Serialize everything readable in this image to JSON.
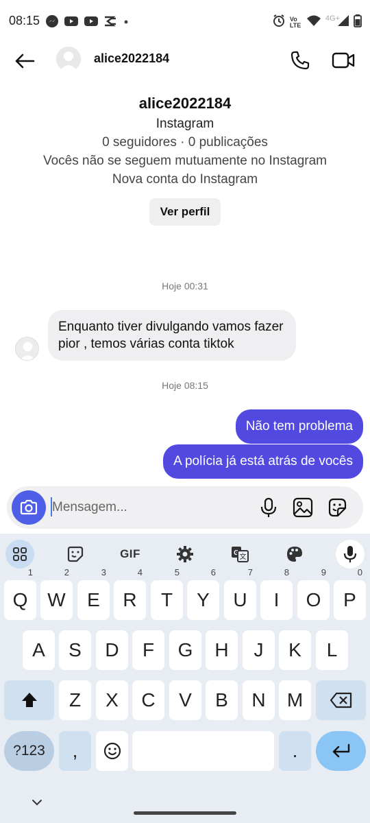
{
  "status_bar": {
    "time": "08:15",
    "left_icons": [
      "messenger-icon",
      "youtube-icon",
      "youtube-icon",
      "capcut-icon",
      "dot-icon"
    ],
    "right_icons": [
      "alarm-icon",
      "volte-icon",
      "wifi-icon",
      "signal-4g-icon",
      "battery-icon"
    ],
    "volte_label": "Vo LTE",
    "network_label": "4G+"
  },
  "header": {
    "username": "alice2022184",
    "icons": [
      "back-arrow-icon",
      "phone-icon",
      "video-call-icon"
    ]
  },
  "profile": {
    "username": "alice2022184",
    "platform": "Instagram",
    "stats": "0 seguidores · 0 publicações",
    "mutual": "Vocês não se seguem mutuamente no Instagram",
    "account_note": "Nova conta do Instagram",
    "view_profile_label": "Ver perfil"
  },
  "messages": [
    {
      "type": "timestamp",
      "text": "Hoje 00:31"
    },
    {
      "type": "incoming",
      "text": "Enquanto tiver divulgando vamos fazer pior , temos várias conta tiktok"
    },
    {
      "type": "timestamp",
      "text": "Hoje 08:15"
    },
    {
      "type": "outgoing",
      "text": "Não tem problema"
    },
    {
      "type": "outgoing",
      "text": "A polícia já está atrás de vocês"
    }
  ],
  "composer": {
    "placeholder": "Mensagem...",
    "icons": [
      "camera-icon",
      "microphone-icon",
      "gallery-icon",
      "sticker-icon"
    ]
  },
  "keyboard": {
    "toolbar": [
      "apps-grid-icon",
      "emoji-sticker-icon",
      "GIF",
      "settings-gear-icon",
      "translate-icon",
      "palette-icon",
      "voice-mic-icon"
    ],
    "gif_label": "GIF",
    "row1": [
      "Q",
      "W",
      "E",
      "R",
      "T",
      "Y",
      "U",
      "I",
      "O",
      "P"
    ],
    "row1_hints": [
      "1",
      "2",
      "3",
      "4",
      "5",
      "6",
      "7",
      "8",
      "9",
      "0"
    ],
    "row2": [
      "A",
      "S",
      "D",
      "F",
      "G",
      "H",
      "J",
      "K",
      "L"
    ],
    "row3": [
      "Z",
      "X",
      "C",
      "V",
      "B",
      "N",
      "M"
    ],
    "symbols_label": "?123",
    "comma_label": ",",
    "period_label": ".",
    "accent_color": "#5249e1"
  }
}
